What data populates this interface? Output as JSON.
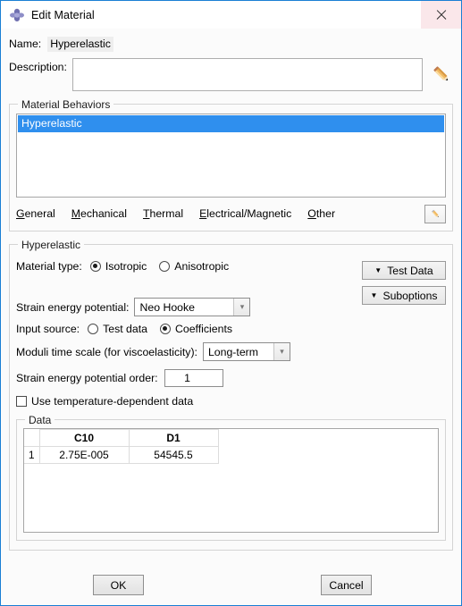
{
  "window": {
    "title": "Edit Material",
    "app_icon": "abaqus-diamond-icon",
    "close_label": "close-icon",
    "border_color": "#1a7fd4",
    "close_bg_color": "#fae7ea"
  },
  "name": {
    "label": "Name:",
    "value": "Hyperelastic"
  },
  "description": {
    "label": "Description:",
    "value": "",
    "placeholder": "",
    "edit_icon": "pencil-icon"
  },
  "material_behaviors": {
    "group_title": "Material Behaviors",
    "items": [
      {
        "label": "Hyperelastic",
        "selected": true
      }
    ],
    "selection_color": "#2f8fee",
    "tabs": [
      {
        "label": "General",
        "mnemonic": "G",
        "rest": "eneral"
      },
      {
        "label": "Mechanical",
        "mnemonic": "M",
        "rest": "echanical"
      },
      {
        "label": "Thermal",
        "mnemonic": "T",
        "rest": "hermal"
      },
      {
        "label": "Electrical/Magnetic",
        "mnemonic": "E",
        "rest": "lectrical/Magnetic"
      },
      {
        "label": "Other",
        "mnemonic": "O",
        "rest": "ther"
      }
    ],
    "edit_icon": "pencil-icon"
  },
  "hyperelastic": {
    "group_title": "Hyperelastic",
    "material_type": {
      "label": "Material type:",
      "options": [
        {
          "label": "Isotropic",
          "selected": true
        },
        {
          "label": "Anisotropic",
          "selected": false
        }
      ]
    },
    "strain_energy_potential": {
      "label": "Strain energy potential:",
      "value": "Neo Hooke"
    },
    "input_source": {
      "label": "Input source:",
      "options": [
        {
          "label": "Test data",
          "selected": false
        },
        {
          "label": "Coefficients",
          "selected": true
        }
      ]
    },
    "moduli_time_scale": {
      "label": "Moduli time scale (for viscoelasticity):",
      "value": "Long-term"
    },
    "potential_order": {
      "label": "Strain energy potential order:",
      "value": "1"
    },
    "temperature_dependent": {
      "label": "Use temperature-dependent data",
      "checked": false
    },
    "side_buttons": [
      {
        "label": "Test Data",
        "arrow": "▼"
      },
      {
        "label": "Suboptions",
        "arrow": "▼"
      }
    ]
  },
  "data_table": {
    "group_title": "Data",
    "columns": [
      "C10",
      "D1"
    ],
    "rows": [
      {
        "index": "1",
        "values": [
          "2.75E-005",
          "54545.5"
        ]
      }
    ]
  },
  "footer": {
    "ok_label": "OK",
    "cancel_label": "Cancel"
  }
}
